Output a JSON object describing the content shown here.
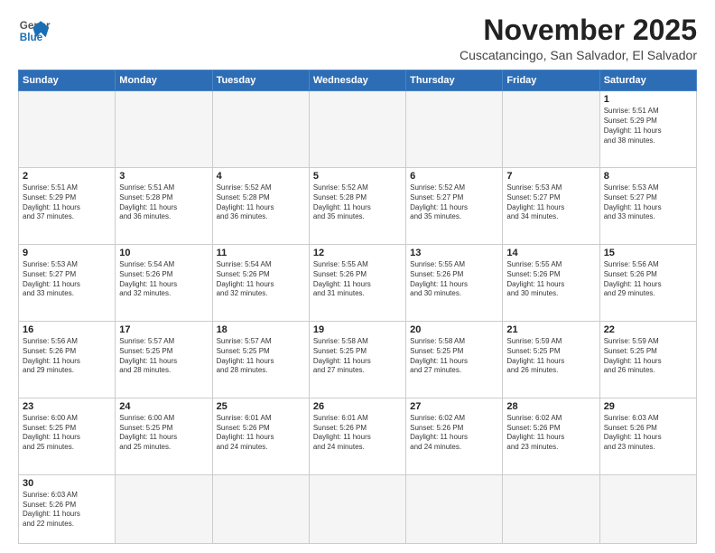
{
  "header": {
    "logo_general": "General",
    "logo_blue": "Blue",
    "month_title": "November 2025",
    "location": "Cuscatancingo, San Salvador, El Salvador"
  },
  "weekdays": [
    "Sunday",
    "Monday",
    "Tuesday",
    "Wednesday",
    "Thursday",
    "Friday",
    "Saturday"
  ],
  "weeks": [
    [
      {
        "day": "",
        "info": ""
      },
      {
        "day": "",
        "info": ""
      },
      {
        "day": "",
        "info": ""
      },
      {
        "day": "",
        "info": ""
      },
      {
        "day": "",
        "info": ""
      },
      {
        "day": "",
        "info": ""
      },
      {
        "day": "1",
        "info": "Sunrise: 5:51 AM\nSunset: 5:29 PM\nDaylight: 11 hours\nand 38 minutes."
      }
    ],
    [
      {
        "day": "2",
        "info": "Sunrise: 5:51 AM\nSunset: 5:29 PM\nDaylight: 11 hours\nand 37 minutes."
      },
      {
        "day": "3",
        "info": "Sunrise: 5:51 AM\nSunset: 5:28 PM\nDaylight: 11 hours\nand 36 minutes."
      },
      {
        "day": "4",
        "info": "Sunrise: 5:52 AM\nSunset: 5:28 PM\nDaylight: 11 hours\nand 36 minutes."
      },
      {
        "day": "5",
        "info": "Sunrise: 5:52 AM\nSunset: 5:28 PM\nDaylight: 11 hours\nand 35 minutes."
      },
      {
        "day": "6",
        "info": "Sunrise: 5:52 AM\nSunset: 5:27 PM\nDaylight: 11 hours\nand 35 minutes."
      },
      {
        "day": "7",
        "info": "Sunrise: 5:53 AM\nSunset: 5:27 PM\nDaylight: 11 hours\nand 34 minutes."
      },
      {
        "day": "8",
        "info": "Sunrise: 5:53 AM\nSunset: 5:27 PM\nDaylight: 11 hours\nand 33 minutes."
      }
    ],
    [
      {
        "day": "9",
        "info": "Sunrise: 5:53 AM\nSunset: 5:27 PM\nDaylight: 11 hours\nand 33 minutes."
      },
      {
        "day": "10",
        "info": "Sunrise: 5:54 AM\nSunset: 5:26 PM\nDaylight: 11 hours\nand 32 minutes."
      },
      {
        "day": "11",
        "info": "Sunrise: 5:54 AM\nSunset: 5:26 PM\nDaylight: 11 hours\nand 32 minutes."
      },
      {
        "day": "12",
        "info": "Sunrise: 5:55 AM\nSunset: 5:26 PM\nDaylight: 11 hours\nand 31 minutes."
      },
      {
        "day": "13",
        "info": "Sunrise: 5:55 AM\nSunset: 5:26 PM\nDaylight: 11 hours\nand 30 minutes."
      },
      {
        "day": "14",
        "info": "Sunrise: 5:55 AM\nSunset: 5:26 PM\nDaylight: 11 hours\nand 30 minutes."
      },
      {
        "day": "15",
        "info": "Sunrise: 5:56 AM\nSunset: 5:26 PM\nDaylight: 11 hours\nand 29 minutes."
      }
    ],
    [
      {
        "day": "16",
        "info": "Sunrise: 5:56 AM\nSunset: 5:26 PM\nDaylight: 11 hours\nand 29 minutes."
      },
      {
        "day": "17",
        "info": "Sunrise: 5:57 AM\nSunset: 5:25 PM\nDaylight: 11 hours\nand 28 minutes."
      },
      {
        "day": "18",
        "info": "Sunrise: 5:57 AM\nSunset: 5:25 PM\nDaylight: 11 hours\nand 28 minutes."
      },
      {
        "day": "19",
        "info": "Sunrise: 5:58 AM\nSunset: 5:25 PM\nDaylight: 11 hours\nand 27 minutes."
      },
      {
        "day": "20",
        "info": "Sunrise: 5:58 AM\nSunset: 5:25 PM\nDaylight: 11 hours\nand 27 minutes."
      },
      {
        "day": "21",
        "info": "Sunrise: 5:59 AM\nSunset: 5:25 PM\nDaylight: 11 hours\nand 26 minutes."
      },
      {
        "day": "22",
        "info": "Sunrise: 5:59 AM\nSunset: 5:25 PM\nDaylight: 11 hours\nand 26 minutes."
      }
    ],
    [
      {
        "day": "23",
        "info": "Sunrise: 6:00 AM\nSunset: 5:25 PM\nDaylight: 11 hours\nand 25 minutes."
      },
      {
        "day": "24",
        "info": "Sunrise: 6:00 AM\nSunset: 5:25 PM\nDaylight: 11 hours\nand 25 minutes."
      },
      {
        "day": "25",
        "info": "Sunrise: 6:01 AM\nSunset: 5:26 PM\nDaylight: 11 hours\nand 24 minutes."
      },
      {
        "day": "26",
        "info": "Sunrise: 6:01 AM\nSunset: 5:26 PM\nDaylight: 11 hours\nand 24 minutes."
      },
      {
        "day": "27",
        "info": "Sunrise: 6:02 AM\nSunset: 5:26 PM\nDaylight: 11 hours\nand 24 minutes."
      },
      {
        "day": "28",
        "info": "Sunrise: 6:02 AM\nSunset: 5:26 PM\nDaylight: 11 hours\nand 23 minutes."
      },
      {
        "day": "29",
        "info": "Sunrise: 6:03 AM\nSunset: 5:26 PM\nDaylight: 11 hours\nand 23 minutes."
      }
    ],
    [
      {
        "day": "30",
        "info": "Sunrise: 6:03 AM\nSunset: 5:26 PM\nDaylight: 11 hours\nand 22 minutes."
      },
      {
        "day": "",
        "info": ""
      },
      {
        "day": "",
        "info": ""
      },
      {
        "day": "",
        "info": ""
      },
      {
        "day": "",
        "info": ""
      },
      {
        "day": "",
        "info": ""
      },
      {
        "day": "",
        "info": ""
      }
    ]
  ]
}
